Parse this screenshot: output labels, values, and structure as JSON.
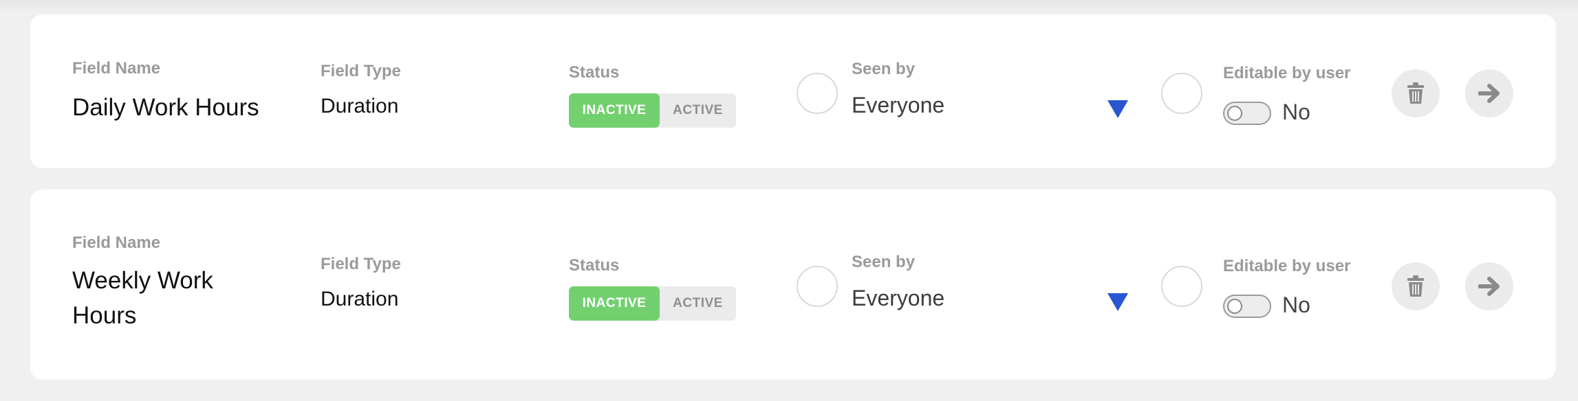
{
  "labels": {
    "field_name": "Field Name",
    "field_type": "Field Type",
    "status": "Status",
    "seen_by": "Seen by",
    "editable_by_user": "Editable by user"
  },
  "rows": [
    {
      "field_name": "Daily Work Hours",
      "field_type": "Duration",
      "status": {
        "inactive_label": "INACTIVE",
        "active_label": "ACTIVE",
        "selected": "INACTIVE"
      },
      "seen_by": "Everyone",
      "editable": {
        "on": false,
        "label": "No"
      }
    },
    {
      "field_name": "Weekly Work Hours",
      "field_type": "Duration",
      "status": {
        "inactive_label": "INACTIVE",
        "active_label": "ACTIVE",
        "selected": "INACTIVE"
      },
      "seen_by": "Everyone",
      "editable": {
        "on": false,
        "label": "No"
      }
    }
  ],
  "icons": {
    "delete": "trash-icon",
    "open": "arrow-right-icon",
    "dropdown": "caret-down-icon"
  },
  "colors": {
    "status_on": "#72d06f",
    "caret": "#2956d1",
    "icon": "#8a8a8a",
    "label": "#9a9a9a"
  }
}
